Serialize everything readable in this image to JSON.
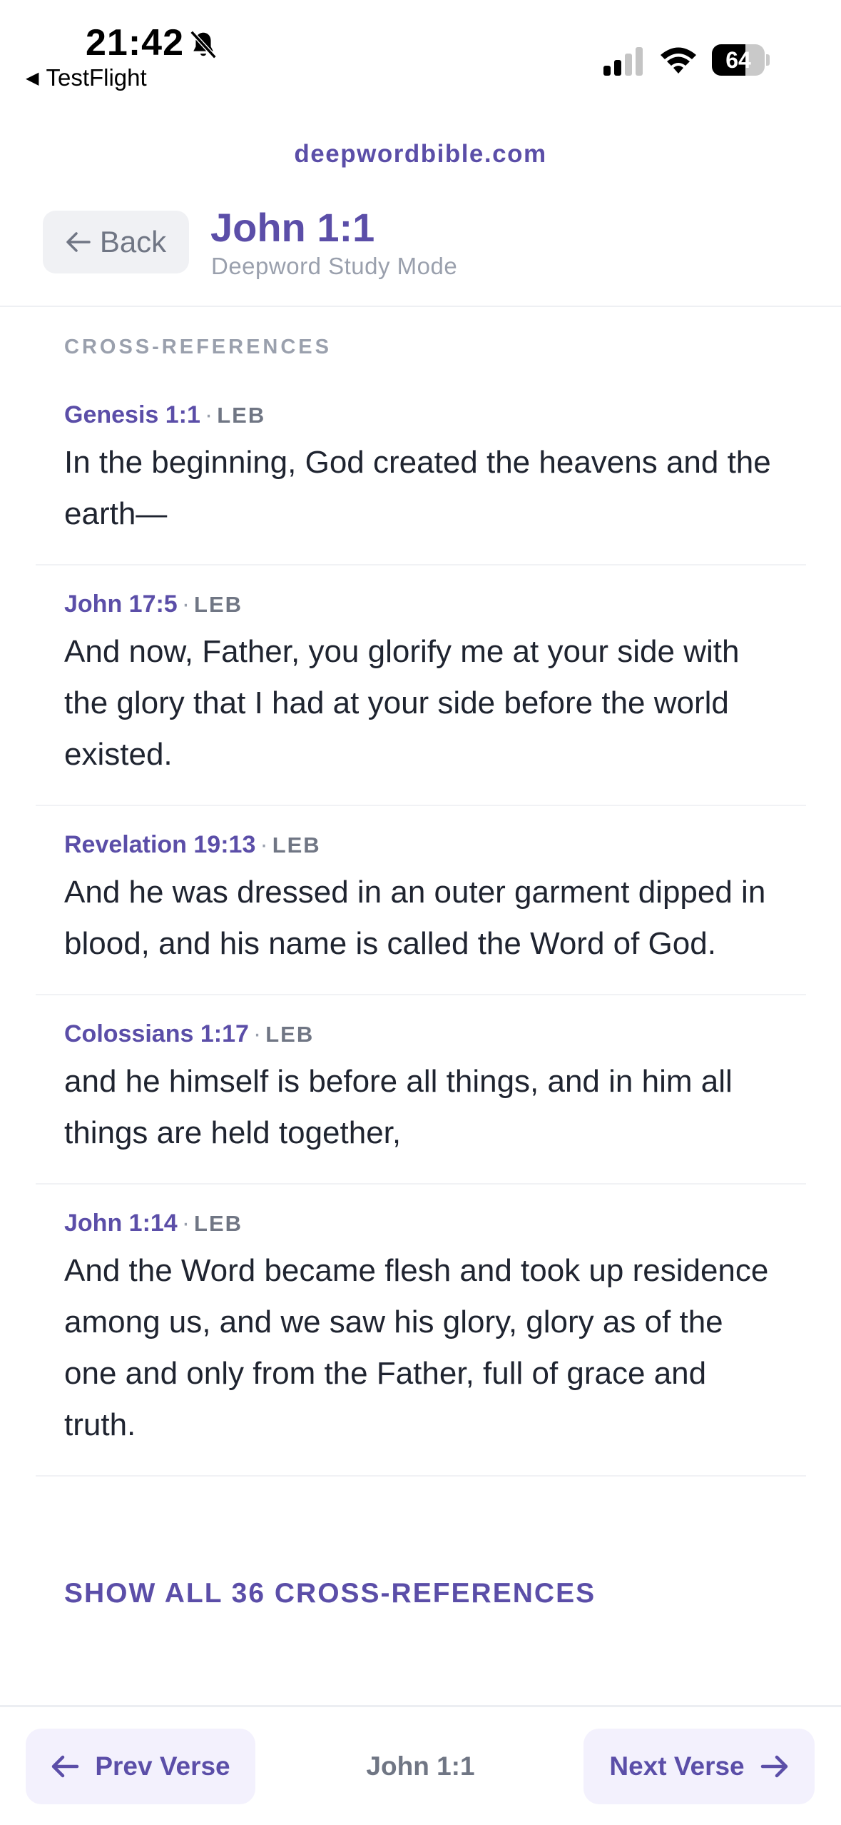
{
  "status_bar": {
    "time": "21:42",
    "back_app": "TestFlight",
    "battery_level": "64",
    "battery_fraction": 0.64,
    "icons": [
      "bell-slash-icon",
      "cellular-signal-icon",
      "wifi-icon",
      "battery-icon"
    ]
  },
  "header": {
    "site_url": "deepwordbible.com",
    "back_label": "Back",
    "title": "John 1:1",
    "subtitle": "Deepword Study Mode"
  },
  "cross_references": {
    "section_label": "CROSS-REFERENCES",
    "items": [
      {
        "ref": "Genesis 1:1",
        "version": "LEB",
        "text": "In the beginning, God created the heavens and the earth—"
      },
      {
        "ref": "John 17:5",
        "version": "LEB",
        "text": "And now, Father, you glorify me at your side with the glory that I had at your side before the world existed."
      },
      {
        "ref": "Revelation 19:13",
        "version": "LEB",
        "text": "And he was dressed in an outer garment dipped in blood, and his name is called the Word of God."
      },
      {
        "ref": "Colossians 1:17",
        "version": "LEB",
        "text": "and he himself is before all things, and in him all things are held together,"
      },
      {
        "ref": "John 1:14",
        "version": "LEB",
        "text": "And the Word became flesh and took up residence among us, and we saw his glory, glory as of the one and only from the Father, full of grace and truth."
      }
    ],
    "show_all_label": "SHOW ALL 36 CROSS-REFERENCES"
  },
  "bottom_nav": {
    "prev_label": "Prev Verse",
    "current": "John 1:1",
    "next_label": "Next Verse"
  },
  "colors": {
    "accent": "#5b4ea8",
    "muted": "#9aa0ad",
    "button_bg": "#f3f1fd"
  }
}
